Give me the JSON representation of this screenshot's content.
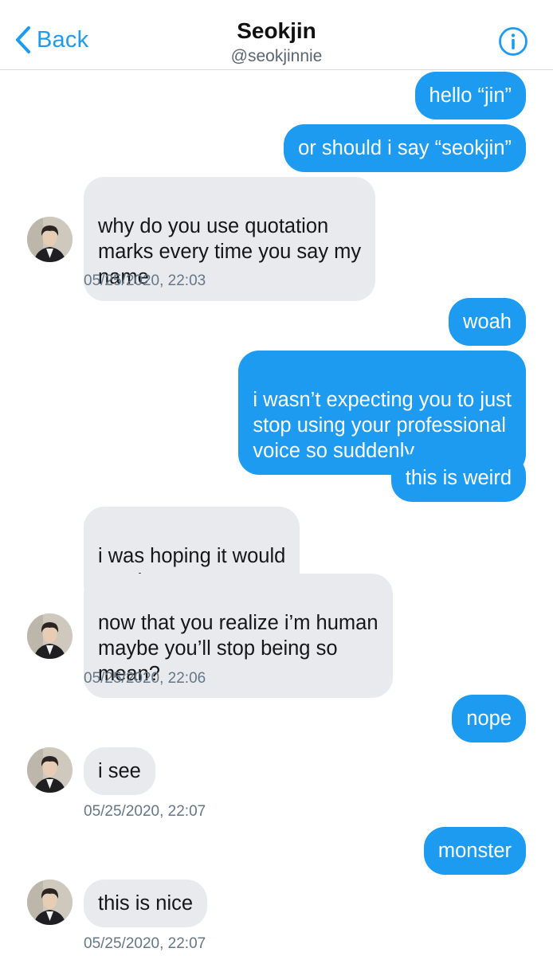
{
  "header": {
    "back_label": "Back",
    "title": "Seokjin",
    "handle": "@seokjinnie",
    "info_icon": "info-icon"
  },
  "colors": {
    "accent": "#1d9bf0",
    "incoming_bubble": "#e8eaed",
    "timestamp": "#657786"
  },
  "messages": [
    {
      "dir": "out",
      "text": "hello “jin”"
    },
    {
      "dir": "out",
      "text": "or should i say “seokjin”"
    },
    {
      "dir": "in",
      "text": "why do you use quotation\nmarks every time you say my\nname"
    },
    {
      "dir": "out",
      "text": "woah"
    },
    {
      "dir": "out",
      "text": "i wasn’t expecting you to just\nstop using your professional\nvoice so suddenly"
    },
    {
      "dir": "out",
      "text": "this is weird"
    },
    {
      "dir": "in",
      "text": "i was hoping it would\nstartle you"
    },
    {
      "dir": "in",
      "text": "now that you realize i’m human\nmaybe you’ll stop being so\nmean?"
    },
    {
      "dir": "out",
      "text": "nope"
    },
    {
      "dir": "in",
      "text": "i see"
    },
    {
      "dir": "out",
      "text": "monster"
    },
    {
      "dir": "in",
      "text": "this is nice"
    }
  ],
  "timestamps": [
    "05/25/2020, 22:03",
    "05/25/2020, 22:06",
    "05/25/2020, 22:07",
    "05/25/2020, 22:07"
  ]
}
